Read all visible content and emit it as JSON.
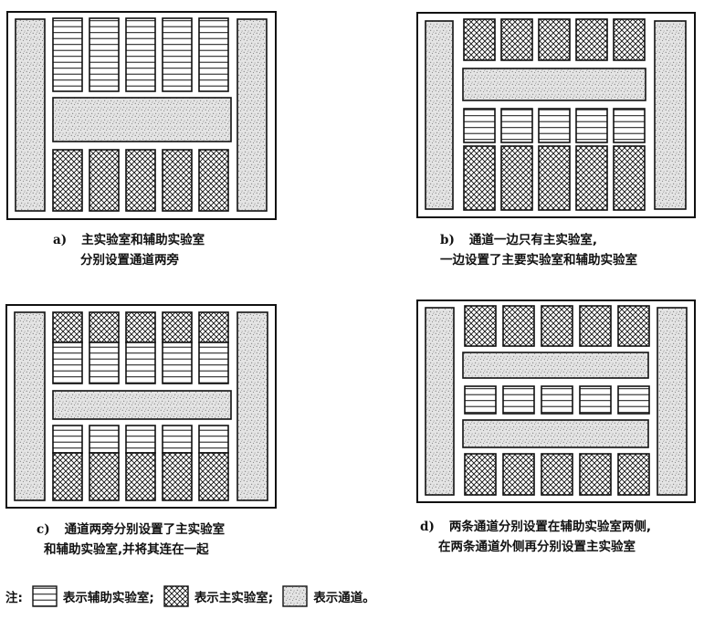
{
  "colors": {
    "stroke": "#111111",
    "corridor_fill": "#e4e4e4",
    "background": "#ffffff"
  },
  "patterns": {
    "auxiliary_lab": "horizontal-lines",
    "main_lab": "crosshatch",
    "corridor": "stipple"
  },
  "panels": [
    {
      "id": "a",
      "label": "a)",
      "caption": [
        "主实验室和辅助实验室",
        "分别设置通道两旁"
      ]
    },
    {
      "id": "b",
      "label": "b)",
      "caption": [
        "通道一边只有主实验室,",
        "一边设置了主要实验室和辅助实验室"
      ]
    },
    {
      "id": "c",
      "label": "c)",
      "caption": [
        "通道两旁分别设置了主实验室",
        "和辅助实验室,并将其连在一起"
      ]
    },
    {
      "id": "d",
      "label": "d)",
      "caption": [
        "两条通道分别设置在辅助实验室两侧,",
        "在两条通道外侧再分别设置主实验室"
      ]
    }
  ],
  "legend": {
    "prefix": "注:",
    "items": [
      {
        "pattern": "horizontal-lines",
        "text": "表示辅助实验室;"
      },
      {
        "pattern": "crosshatch",
        "text": "表示主实验室;"
      },
      {
        "pattern": "stipple",
        "text": "表示通道。"
      }
    ]
  }
}
